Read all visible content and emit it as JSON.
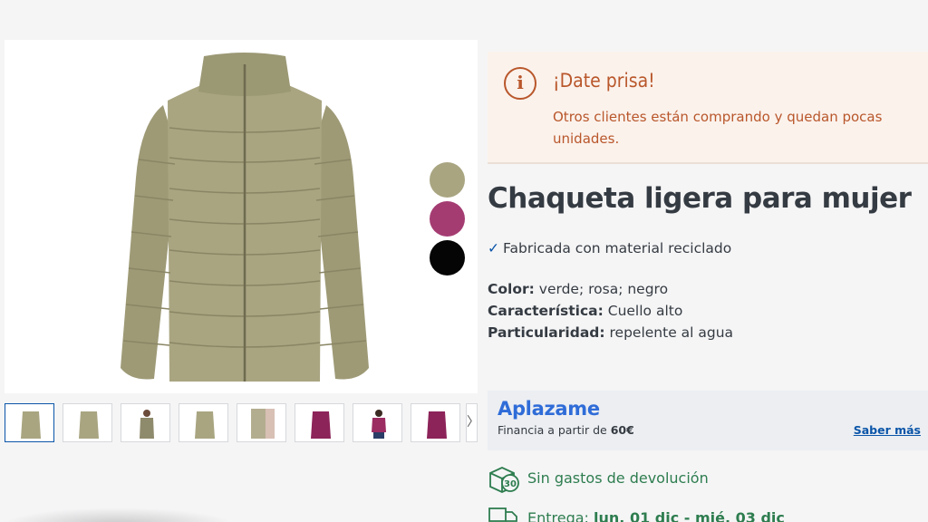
{
  "product": {
    "title": "Chaqueta ligera para mujer",
    "feature_check": "✓",
    "feature": "Fabricada con material reciclado",
    "attributes": [
      {
        "label": "Color:",
        "value": "verde; rosa; negro"
      },
      {
        "label": "Característica:",
        "value": "Cuello alto"
      },
      {
        "label": "Particularidad:",
        "value": "repelente al agua"
      }
    ],
    "swatches": [
      {
        "name": "verde",
        "color": "#a9a581"
      },
      {
        "name": "rosa",
        "color": "#a43c72"
      },
      {
        "name": "negro",
        "color": "#050505"
      }
    ]
  },
  "alert": {
    "icon": "info-icon",
    "icon_glyph": "i",
    "title": "¡Date prisa!",
    "body": "Otros clientes están comprando y quedan pocas unidades."
  },
  "aplazame": {
    "logo": "Aplazame",
    "text_prefix": "Financia a partir de ",
    "amount": "60€",
    "link": "Saber más"
  },
  "shipping": {
    "returns": "Sin gastos de devolución",
    "returns_badge": "30",
    "delivery_prefix": "Entrega: ",
    "delivery_dates": "lun. 01 dic - mié. 03 dic"
  },
  "gallery": {
    "next_arrow": "〉",
    "thumbnails": [
      {
        "name": "thumb-green-front",
        "color": "#a9a581",
        "active": true
      },
      {
        "name": "thumb-green-front-2",
        "color": "#a9a581"
      },
      {
        "name": "thumb-green-model",
        "color": "#8e8a6c"
      },
      {
        "name": "thumb-green-back",
        "color": "#a9a581"
      },
      {
        "name": "thumb-green-detail",
        "color": "#b3ad90"
      },
      {
        "name": "thumb-pink-front",
        "color": "#8c2359"
      },
      {
        "name": "thumb-pink-model",
        "color": "#9b2c61"
      },
      {
        "name": "thumb-pink-back",
        "color": "#8c2359"
      }
    ]
  },
  "colors": {
    "alert_accent": "#b9572b",
    "link_blue": "#0b55a8",
    "success_green": "#2e7d4f",
    "aplazame_blue": "#2f6cd8"
  }
}
